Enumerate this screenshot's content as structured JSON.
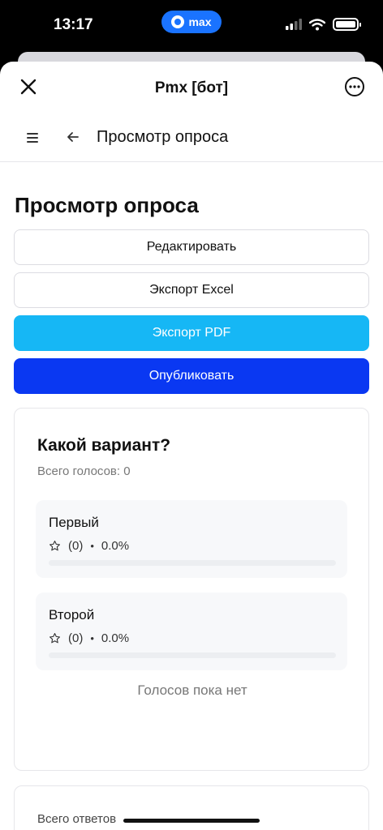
{
  "status_bar": {
    "time": "13:17",
    "app_pill": "max",
    "icons": [
      "signal-icon",
      "wifi-icon",
      "battery-icon"
    ]
  },
  "header": {
    "title": "Pmx [бот]",
    "icons": [
      "close-icon",
      "more-icon"
    ]
  },
  "nav": {
    "title": "Просмотр опроса",
    "icons": [
      "menu-icon",
      "back-arrow-icon"
    ]
  },
  "page": {
    "title": "Просмотр опроса"
  },
  "buttons": {
    "edit": "Редактировать",
    "excel": "Экспорт Excel",
    "pdf": "Экспорт PDF",
    "publish": "Опубликовать"
  },
  "poll": {
    "question": "Какой вариант?",
    "total_votes": "Всего голосов: 0",
    "options": [
      {
        "name": "Первый",
        "count": "(0)",
        "percent": "0.0%",
        "fraction": 0
      },
      {
        "name": "Второй",
        "count": "(0)",
        "percent": "0.0%",
        "fraction": 0
      }
    ],
    "dot": "•",
    "empty": "Голосов пока нет"
  },
  "answers": {
    "label": "Всего ответов"
  },
  "colors": {
    "accent_blue": "#0a38f2",
    "accent_cyan": "#16b7f5",
    "pill_blue": "#1a73ff"
  }
}
